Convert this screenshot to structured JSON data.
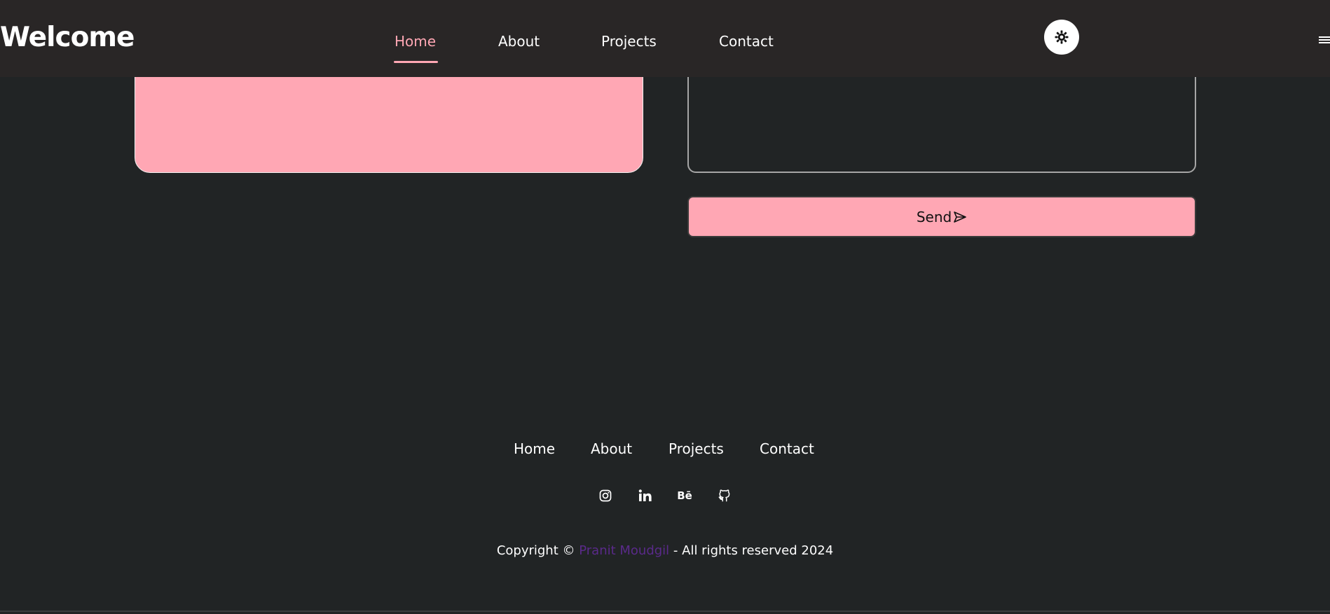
{
  "header": {
    "brand": "Welcome",
    "nav": [
      {
        "label": "Home",
        "active": true
      },
      {
        "label": "About",
        "active": false
      },
      {
        "label": "Projects",
        "active": false
      },
      {
        "label": "Contact",
        "active": false
      }
    ],
    "theme_toggle_icon": "sun-icon",
    "menu_icon": "hamburger-icon"
  },
  "contact": {
    "message_value": "",
    "send_label": "Send",
    "send_icon": "paper-plane-icon"
  },
  "footer": {
    "nav": [
      {
        "label": "Home"
      },
      {
        "label": "About"
      },
      {
        "label": "Projects"
      },
      {
        "label": "Contact"
      }
    ],
    "socials": [
      "instagram-icon",
      "linkedin-icon",
      "behance-icon",
      "github-icon"
    ],
    "behance_glyph": "Bē",
    "copyright_prefix": "Copyright © ",
    "copyright_owner": "Pranit Moudgil",
    "copyright_suffix": " - All rights reserved 2024"
  },
  "colors": {
    "background": "#212425",
    "header_background": "#292626",
    "accent_pink": "#ffa7b4",
    "owner_link": "#5a2a8a"
  }
}
